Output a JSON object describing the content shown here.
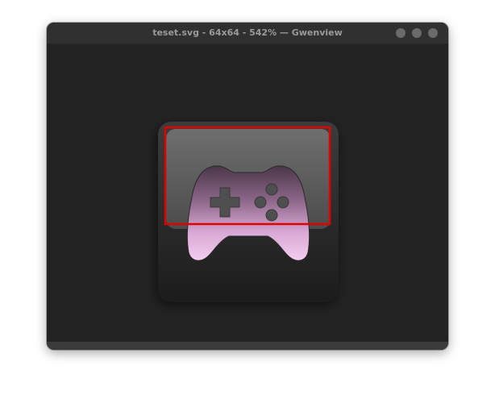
{
  "window": {
    "title": "teset.svg - 64x64 - 542% — Gwenview"
  },
  "icon": "gamepad-icon",
  "colors": {
    "selection": "#e00000",
    "controller_top": "#4e3a4b",
    "controller_bottom": "#f0c8ec"
  }
}
